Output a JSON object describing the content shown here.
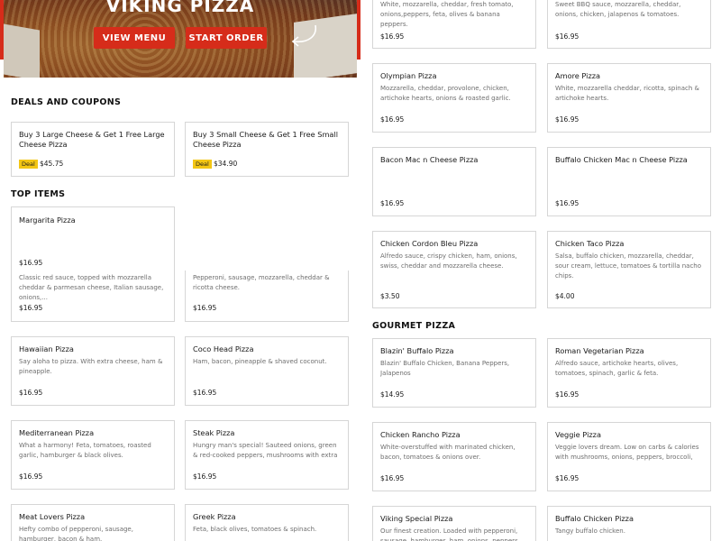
{
  "hero": {
    "title": "VIKING PIZZA",
    "view_menu": "VIEW MENU",
    "start_order": "START ORDER"
  },
  "sections": {
    "deals": "DEALS AND COUPONS",
    "top": "TOP ITEMS",
    "gourmet": "GOURMET PIZZA"
  },
  "deals": [
    {
      "name": "Buy 3 Large Cheese & Get 1 Free Large Cheese Pizza",
      "badge": "Deal",
      "price": "$45.75"
    },
    {
      "name": "Buy 3 Small Cheese & Get 1 Free Small Cheese Pizza",
      "badge": "Deal",
      "price": "$34.90"
    }
  ],
  "top_items": [
    {
      "name": "Margarita Pizza",
      "desc": "",
      "price": "$16.95"
    },
    {
      "name": "",
      "desc": "Classic red sauce, topped with mozzarella cheddar & parmesan cheese, Italian sausage, onions,...",
      "price": "$16.95"
    },
    {
      "name": "",
      "desc": "Pepperoni, sausage, mozzarella, cheddar & ricotta cheese.",
      "price": "$16.95"
    },
    {
      "name": "Hawaiian Pizza",
      "desc": "Say aloha to pizza. With extra cheese, ham & pineapple.",
      "price": "$16.95"
    },
    {
      "name": "Coco Head Pizza",
      "desc": "Ham, bacon, pineapple & shaved coconut.",
      "price": "$16.95"
    },
    {
      "name": "Mediterranean Pizza",
      "desc": "What a harmony! Feta, tomatoes, roasted garlic, hamburger & black olives.",
      "price": "$16.95"
    },
    {
      "name": "Steak Pizza",
      "desc": "Hungry man's special! Sauteed onions, green & red-cooked peppers, mushrooms with extra lean...",
      "price": "$16.95"
    },
    {
      "name": "Meat Lovers Pizza",
      "desc": "Hefty combo of pepperoni, sausage, hamburger, bacon & ham.",
      "price": ""
    },
    {
      "name": "Greek Pizza",
      "desc": "Feta, black olives, tomatoes & spinach.",
      "price": ""
    }
  ],
  "right_items": [
    {
      "name": "",
      "desc": "White, mozzarella, cheddar, fresh tomato, onions,peppers, feta, olives & banana peppers.",
      "price": "$16.95"
    },
    {
      "name": "",
      "desc": "Sweet BBQ sauce, mozzarella, cheddar, onions, chicken, jalapenos & tomatoes.",
      "price": "$16.95"
    },
    {
      "name": "Olympian Pizza",
      "desc": "Mozzarella, cheddar, provolone, chicken, artichoke hearts, onions & roasted garlic.",
      "price": "$16.95"
    },
    {
      "name": "Amore Pizza",
      "desc": "White, mozzarella cheddar, ricotta, spinach & artichoke hearts.",
      "price": "$16.95"
    },
    {
      "name": "Bacon Mac n Cheese Pizza",
      "desc": "",
      "price": "$16.95"
    },
    {
      "name": "Buffalo Chicken Mac n Cheese Pizza",
      "desc": "",
      "price": "$16.95"
    },
    {
      "name": "Chicken Cordon Bleu Pizza",
      "desc": "Alfredo sauce, crispy chicken, ham, onions, swiss, cheddar and mozzarella cheese.",
      "price": "$3.50"
    },
    {
      "name": "Chicken Taco Pizza",
      "desc": "Salsa, buffalo chicken, mozzarella, cheddar, sour cream, lettuce, tomatoes & tortilla nacho chips.",
      "price": "$4.00"
    }
  ],
  "gourmet_items": [
    {
      "name": "Blazin' Buffalo Pizza",
      "desc": "Blazin' Buffalo Chicken, Banana Peppers, Jalapenos",
      "price": "$14.95"
    },
    {
      "name": "Roman Vegetarian Pizza",
      "desc": "Alfredo sauce, artichoke hearts, olives, tomatoes, spinach, garlic & feta.",
      "price": "$16.95"
    },
    {
      "name": "Chicken Rancho Pizza",
      "desc": "White-overstuffed with marinated chicken, bacon, tomatoes & onions over.",
      "price": "$16.95"
    },
    {
      "name": "Veggie Pizza",
      "desc": "Veggie lovers dream. Low on carbs & calories with mushrooms, onions, peppers, broccoli, spinach,...",
      "price": "$16.95"
    },
    {
      "name": "Viking Special Pizza",
      "desc": "Our finest creation. Loaded with pepperoni, sausage, hamburger, ham, onions, peppers...",
      "price": ""
    },
    {
      "name": "Buffalo Chicken Pizza",
      "desc": "Tangy buffalo chicken.",
      "price": ""
    }
  ],
  "colors": {
    "brand": "#d62c1a",
    "deal": "#f3c614"
  }
}
